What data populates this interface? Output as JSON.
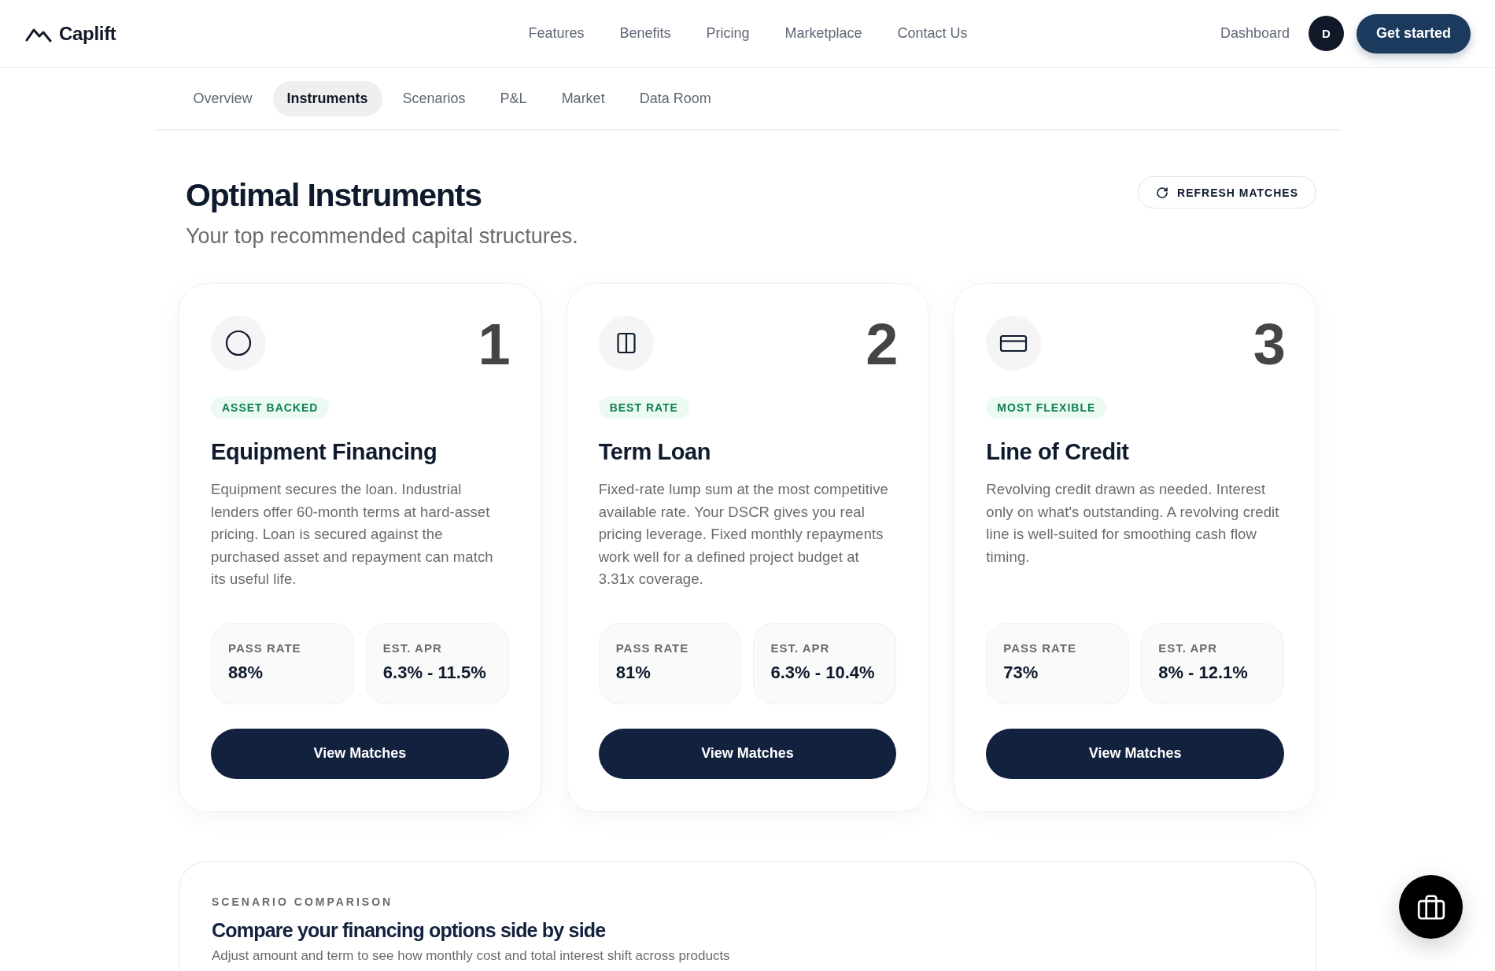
{
  "header": {
    "logo": "Caplift",
    "nav": [
      "Features",
      "Benefits",
      "Pricing",
      "Marketplace",
      "Contact Us"
    ],
    "dashboard_link": "Dashboard",
    "avatar_initial": "D",
    "cta": "Get started"
  },
  "tabs": [
    {
      "label": "Overview",
      "selected": false
    },
    {
      "label": "Instruments",
      "selected": true
    },
    {
      "label": "Scenarios",
      "selected": false
    },
    {
      "label": "P&L",
      "selected": false
    },
    {
      "label": "Market",
      "selected": false
    },
    {
      "label": "Data Room",
      "selected": false
    }
  ],
  "page": {
    "title": "Optimal Instruments",
    "subtitle": "Your top recommended capital structures.",
    "refresh_button": "REFRESH MATCHES"
  },
  "instruments": [
    {
      "rank": "1",
      "badge": "ASSET BACKED",
      "title": "Equipment Financing",
      "description": "Equipment secures the loan. Industrial lenders offer 60-month terms at hard-asset pricing. Loan is secured against the purchased asset and repayment can match its useful life.",
      "stats": [
        {
          "label": "PASS RATE",
          "value": "88%"
        },
        {
          "label": "EST. APR",
          "value": "6.3% - 11.5%"
        }
      ],
      "button": "View Matches"
    },
    {
      "rank": "2",
      "badge": "BEST RATE",
      "title": "Term Loan",
      "description": "Fixed-rate lump sum at the most competitive available rate. Your DSCR gives you real pricing leverage. Fixed monthly repayments work well for a defined project budget at 3.31x coverage.",
      "stats": [
        {
          "label": "PASS RATE",
          "value": "81%"
        },
        {
          "label": "EST. APR",
          "value": "6.3% - 10.4%"
        }
      ],
      "button": "View Matches"
    },
    {
      "rank": "3",
      "badge": "MOST FLEXIBLE",
      "title": "Line of Credit",
      "description": "Revolving credit drawn as needed. Interest only on what's outstanding. A revolving credit line is well-suited for smoothing cash flow timing.",
      "stats": [
        {
          "label": "PASS RATE",
          "value": "73%"
        },
        {
          "label": "EST. APR",
          "value": "8% - 12.1%"
        }
      ],
      "button": "View Matches"
    }
  ],
  "scenario_comparison": {
    "eyebrow": "SCENARIO COMPARISON",
    "title": "Compare your financing options side by side",
    "subtitle": "Adjust amount and term to see how monthly cost and total interest shift across products"
  }
}
